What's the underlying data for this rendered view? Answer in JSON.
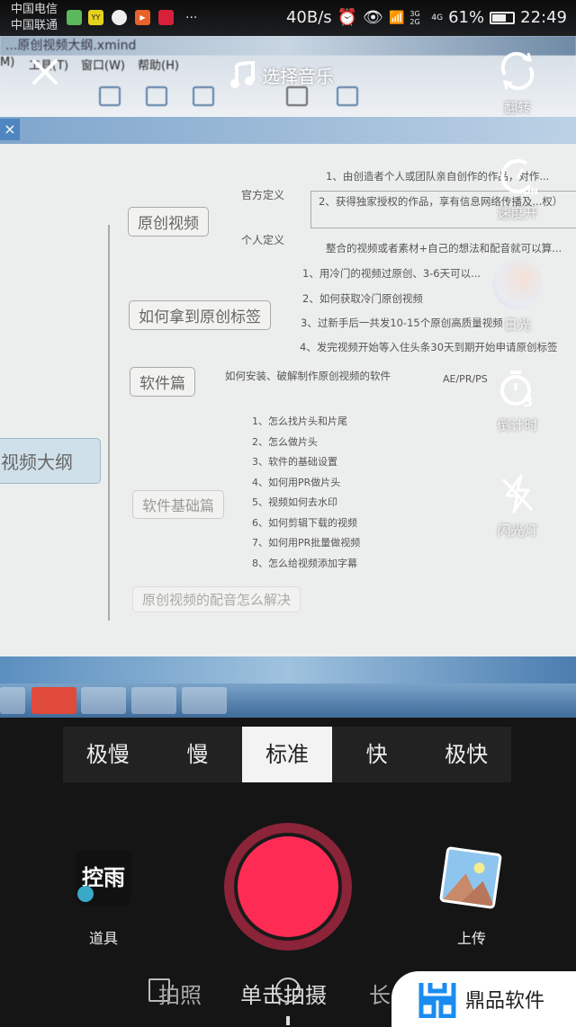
{
  "status_bar": {
    "carrier1": "中国电信",
    "carrier2": "中国联通",
    "net_speed": "40B/s",
    "signal1": "3G 2G",
    "signal2": "4G",
    "battery": "61%",
    "battery_level": 0.61,
    "time": "22:49",
    "more": "..."
  },
  "background_photo": {
    "window_title": "...原创视频大纲.xmind",
    "menu": [
      "M)",
      "工具(T)",
      "窗口(W)",
      "帮助(H)"
    ],
    "tab_close": "×",
    "mindmap": {
      "root": "视频大纲",
      "branches": [
        {
          "label": "原创视频",
          "subs": [
            {
              "label": "官方定义",
              "items": [
                "1、由创造者个人或团队亲自创作的作品，对作...",
                "2、获得独家授权的作品，享有信息网络传播及...权）"
              ]
            },
            {
              "label": "个人定义",
              "items": [
                "整合的视频或者素材+自己的想法和配音就可以算..."
              ]
            }
          ]
        },
        {
          "label": "如何拿到原创标签",
          "items": [
            "1、用冷门的视频过原创、3-6天可以...",
            "2、如何获取冷门原创视频",
            "3、过新手后一共发10-15个原创高质量视频",
            "4、发完视频开始等入住头条30天到期开始申请原创标签"
          ]
        },
        {
          "label": "软件篇",
          "items": [
            "如何安装、破解制作原创视频的软件",
            "AE/PR/PS"
          ]
        },
        {
          "label": "软件基础篇",
          "items": [
            "1、怎么找片头和片尾",
            "2、怎么做片头",
            "3、软件的基础设置",
            "4、如何用PR做片头",
            "5、视频如何去水印",
            "6、如何剪辑下载的视频",
            "7、如何用PR批量做视频",
            "8、怎么给视频添加字幕"
          ]
        },
        {
          "label": "原创视频的配音怎么解决"
        }
      ]
    }
  },
  "top_bar": {
    "close": "close-icon",
    "music_label": "选择音乐"
  },
  "right_tools": [
    {
      "label": "翻转",
      "icon": "flip-camera-icon"
    },
    {
      "label": "速度开",
      "icon": "speed-icon",
      "badge": "ON"
    },
    {
      "label": "日光",
      "icon": "beauty-filter-avatar"
    },
    {
      "label": "倒计时",
      "icon": "countdown-timer-icon",
      "badge": "3"
    },
    {
      "label": "闪光灯",
      "icon": "flash-off-icon"
    }
  ],
  "speed_options": [
    "极慢",
    "慢",
    "标准",
    "快",
    "极快"
  ],
  "speed_selected": "标准",
  "props": {
    "label": "道具",
    "thumb_text": "控雨"
  },
  "upload": {
    "label": "上传"
  },
  "modes": [
    "拍照",
    "单击拍摄",
    "长"
  ],
  "watermark": "鼎品软件",
  "colors": {
    "record": "#fe2c55",
    "record_ring": "#8b2439",
    "watermark_blue": "#1a8cf0"
  }
}
